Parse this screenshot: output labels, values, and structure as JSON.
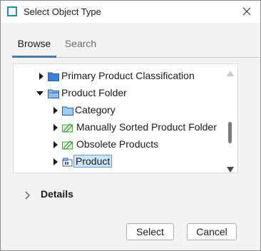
{
  "window": {
    "title": "Select Object Type",
    "app_icon": "window-square-icon",
    "close_icon": "close-icon"
  },
  "tabs": [
    {
      "label": "Browse",
      "active": true
    },
    {
      "label": "Search",
      "active": false
    }
  ],
  "tree": {
    "items": [
      {
        "label": "Primary Product Classification",
        "icon": "folder-icon-blue",
        "expanded": false,
        "level": 1
      },
      {
        "label": "Product Folder",
        "icon": "folder-icon-open",
        "expanded": true,
        "level": 1
      },
      {
        "label": "Category",
        "icon": "folder-icon-light",
        "expanded": false,
        "level": 2
      },
      {
        "label": "Manually Sorted Product Folder",
        "icon": "green-folder-edit-icon",
        "expanded": false,
        "level": 2
      },
      {
        "label": "Obsolete Products",
        "icon": "green-folder-edit-icon",
        "expanded": false,
        "level": 2
      },
      {
        "label": "Product",
        "icon": "product-icon",
        "expanded": false,
        "level": 2,
        "selected": true
      }
    ]
  },
  "details": {
    "label": "Details",
    "expanded": false
  },
  "buttons": {
    "select_label": "Select",
    "cancel_label": "Cancel"
  },
  "colors": {
    "accent": "#4b7aa6",
    "selection_bg": "#cce4f7",
    "selection_border": "#6a9fd0",
    "folder_blue": "#3c7fd0",
    "green_icon": "#3aa03a",
    "title_icon": "#2a8a9a"
  }
}
